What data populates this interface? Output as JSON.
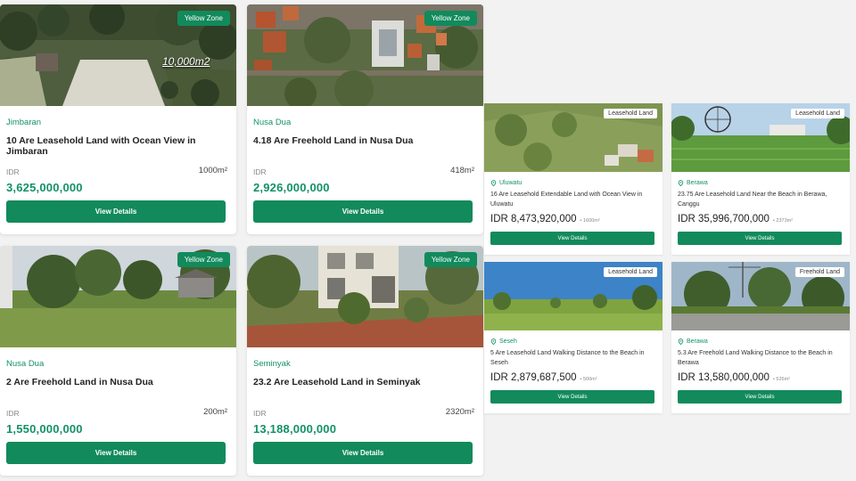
{
  "large_cards": [
    {
      "zone": "Yellow Zone",
      "location": "Jimbaran",
      "title": "10 Are Leasehold Land with Ocean View in Jimbaran",
      "currency": "IDR",
      "price": "3,625,000,000",
      "area": "1000m²",
      "image_overlay": "10,000m2",
      "button": "View Details"
    },
    {
      "zone": "Yellow Zone",
      "location": "Nusa Dua",
      "title": "4.18 Are Freehold Land in Nusa Dua",
      "currency": "IDR",
      "price": "2,926,000,000",
      "area": "418m²",
      "button": "View Details"
    },
    {
      "zone": "Yellow Zone",
      "location": "Nusa Dua",
      "title": "2 Are Freehold Land in Nusa Dua",
      "currency": "IDR",
      "price": "1,550,000,000",
      "area": "200m²",
      "button": "View Details"
    },
    {
      "zone": "Yellow Zone",
      "location": "Seminyak",
      "title": "23.2 Are Leasehold Land in Seminyak",
      "currency": "IDR",
      "price": "13,188,000,000",
      "area": "2320m²",
      "button": "View Details"
    }
  ],
  "small_cards": [
    {
      "tag": "Leasehold Land",
      "location": "Uluwatu",
      "title": "16 Are Leasehold Extendable Land with Ocean View in Uluwatu",
      "price": "IDR 8,473,920,000",
      "area": "• 1600m²",
      "button": "View Details"
    },
    {
      "tag": "Leasehold Land",
      "location": "Berawa",
      "title": "23.75 Are Leasehold Land Near the Beach in Berawa, Canggu",
      "price": "IDR 35,996,700,000",
      "area": "• 2373m²",
      "button": "View Details"
    },
    {
      "tag": "Leasehold Land",
      "location": "Seseh",
      "title": "5 Are Leasehold Land Walking Distance to the Beach in Seseh",
      "price": "IDR 2,879,687,500",
      "area": "• 500m²",
      "button": "View Details"
    },
    {
      "tag": "Freehold Land",
      "location": "Berawa",
      "title": "5.3 Are Freehold Land Walking Distance to the Beach in Berawa",
      "price": "IDR 13,580,000,000",
      "area": "• 526m²",
      "button": "View Details"
    }
  ],
  "colors": {
    "accent": "#128a5c",
    "accent_text": "#149165"
  }
}
